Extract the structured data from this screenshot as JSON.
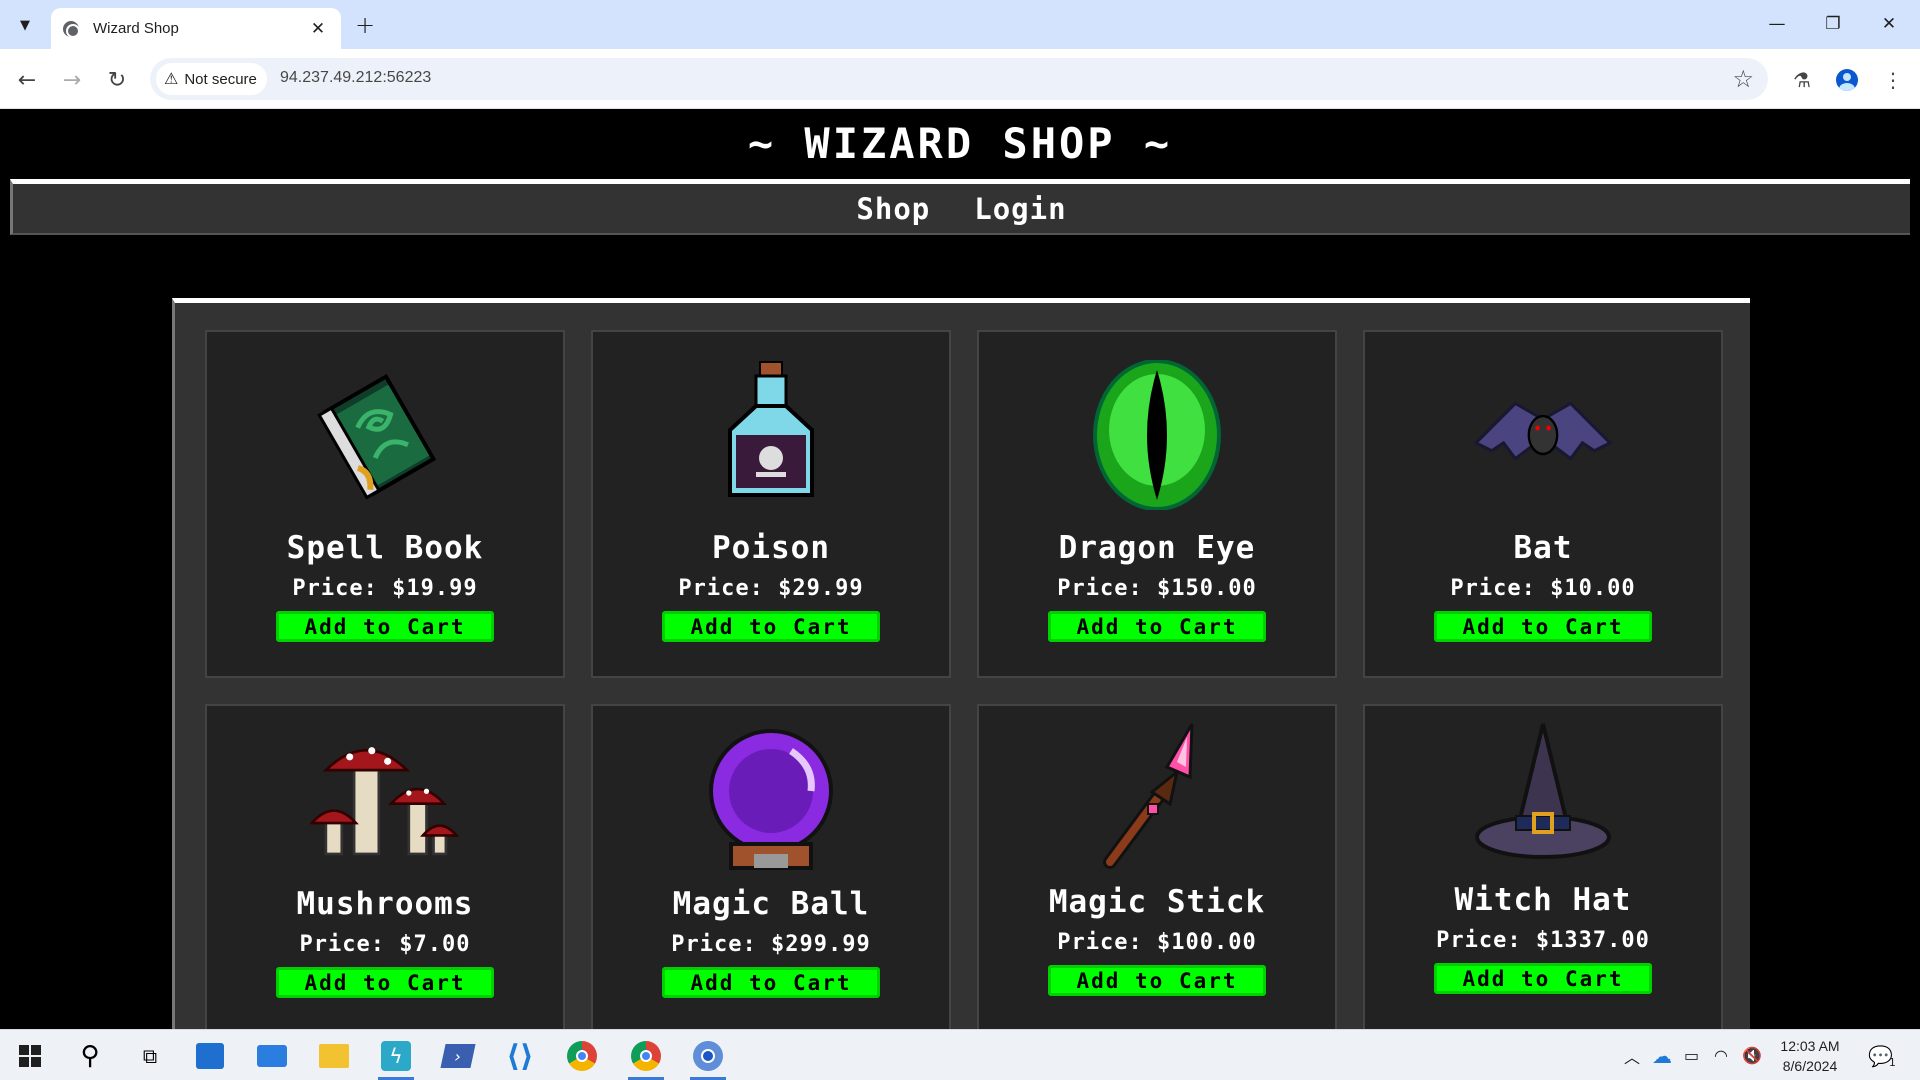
{
  "browser": {
    "tab_title": "Wizard Shop",
    "secure_label": "Not secure",
    "url": "94.237.49.212:56223"
  },
  "site": {
    "title": "~ WIZARD SHOP ~",
    "nav": [
      {
        "label": "Shop"
      },
      {
        "label": "Login"
      }
    ]
  },
  "products": [
    {
      "name": "Spell Book",
      "price": "Price: $19.99",
      "button": "Add to Cart",
      "icon": "spell-book-icon"
    },
    {
      "name": "Poison",
      "price": "Price: $29.99",
      "button": "Add to Cart",
      "icon": "poison-bottle-icon"
    },
    {
      "name": "Dragon Eye",
      "price": "Price: $150.00",
      "button": "Add to Cart",
      "icon": "dragon-eye-icon"
    },
    {
      "name": "Bat",
      "price": "Price: $10.00",
      "button": "Add to Cart",
      "icon": "bat-icon"
    },
    {
      "name": "Mushrooms",
      "price": "Price: $7.00",
      "button": "Add to Cart",
      "icon": "mushrooms-icon"
    },
    {
      "name": "Magic Ball",
      "price": "Price: $299.99",
      "button": "Add to Cart",
      "icon": "crystal-ball-icon"
    },
    {
      "name": "Magic Stick",
      "price": "Price: $100.00",
      "button": "Add to Cart",
      "icon": "magic-wand-icon"
    },
    {
      "name": "Witch Hat",
      "price": "Price: $1337.00",
      "button": "Add to Cart",
      "icon": "witch-hat-icon"
    }
  ],
  "taskbar": {
    "time": "12:03 AM",
    "date": "8/6/2024",
    "notification_count": "1"
  },
  "colors": {
    "button_green": "#00ff00",
    "panel": "#333333",
    "card": "#222222"
  }
}
